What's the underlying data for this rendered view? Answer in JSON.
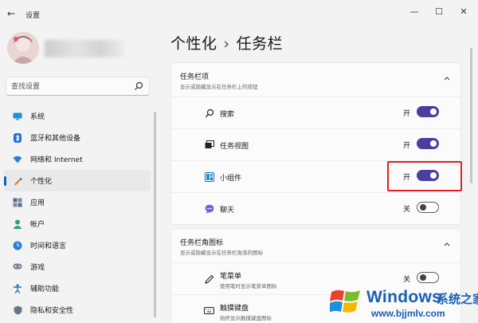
{
  "window": {
    "title": "设置",
    "back_icon": "back-arrow-icon"
  },
  "search": {
    "placeholder": "查找设置"
  },
  "nav": {
    "items": [
      {
        "label": "系统",
        "icon": "monitor-icon"
      },
      {
        "label": "蓝牙和其他设备",
        "icon": "bluetooth-icon"
      },
      {
        "label": "网络和 Internet",
        "icon": "wifi-icon"
      },
      {
        "label": "个性化",
        "icon": "pen-icon",
        "active": true
      },
      {
        "label": "应用",
        "icon": "apps-icon"
      },
      {
        "label": "帐户",
        "icon": "person-icon"
      },
      {
        "label": "时间和语言",
        "icon": "globe-clock-icon"
      },
      {
        "label": "游戏",
        "icon": "gamepad-icon"
      },
      {
        "label": "辅助功能",
        "icon": "accessibility-icon"
      },
      {
        "label": "隐私和安全性",
        "icon": "shield-icon"
      }
    ]
  },
  "page": {
    "breadcrumb_parent": "个性化",
    "breadcrumb_sep": "›",
    "breadcrumb_current": "任务栏"
  },
  "taskbar_items": {
    "title": "任务栏项",
    "subtitle": "显示或隐藏显示在任务栏上的按钮",
    "rows": [
      {
        "label": "搜索",
        "state_text": "开",
        "on": true,
        "icon": "search-icon"
      },
      {
        "label": "任务视图",
        "state_text": "开",
        "on": true,
        "icon": "task-view-icon"
      },
      {
        "label": "小组件",
        "state_text": "开",
        "on": true,
        "icon": "widgets-icon"
      },
      {
        "label": "聊天",
        "state_text": "关",
        "on": false,
        "icon": "chat-icon"
      }
    ]
  },
  "corner_icons": {
    "title": "任务栏角图标",
    "subtitle": "显示或隐藏显示在任务栏角落的图标",
    "rows": [
      {
        "label": "笔菜单",
        "sub": "使用笔时显示笔菜单图标",
        "state_text": "关",
        "on": false,
        "icon": "pen-menu-icon"
      },
      {
        "label": "触摸键盘",
        "sub": "始终显示触摸键盘图标",
        "icon": "keyboard-icon"
      }
    ]
  },
  "watermark": {
    "brand": "Windows",
    "cn": "系统之家",
    "url": "www.bjjmlv.com"
  },
  "colors": {
    "accent": "#4a3f9f",
    "highlight": "#e02020",
    "watermark": "#1a5fb4"
  }
}
